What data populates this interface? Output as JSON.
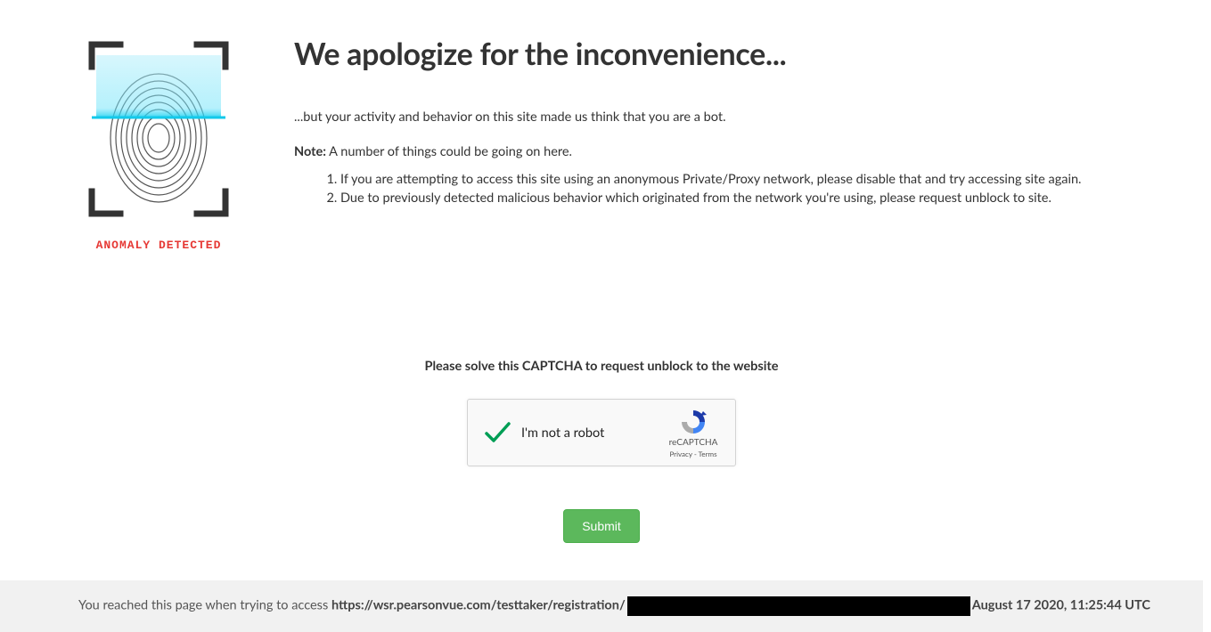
{
  "logo_caption": "ANOMALY DETECTED",
  "heading": "We apologize for the inconvenience...",
  "intro": "...but your activity and behavior on this site made us think that you are a bot.",
  "note_label": "Note:",
  "note_rest": " A number of things could be going on here.",
  "reasons": [
    "If you are attempting to access this site using an anonymous Private/Proxy network, please disable that and try accessing site again.",
    "Due to previously detected malicious behavior which originated from the network you're using, please request unblock to site."
  ],
  "captcha_title": "Please solve this CAPTCHA to request unblock to the website",
  "recaptcha": {
    "label": "I'm not a robot",
    "brand": "reCAPTCHA",
    "privacy": "Privacy",
    "terms": "Terms"
  },
  "submit_label": "Submit",
  "footer": {
    "prefix": "You reached this page when trying to access ",
    "url": "https://wsr.pearsonvue.com/testtaker/registration/",
    "timestamp": "August 17 2020, 11:25:44 UTC"
  }
}
